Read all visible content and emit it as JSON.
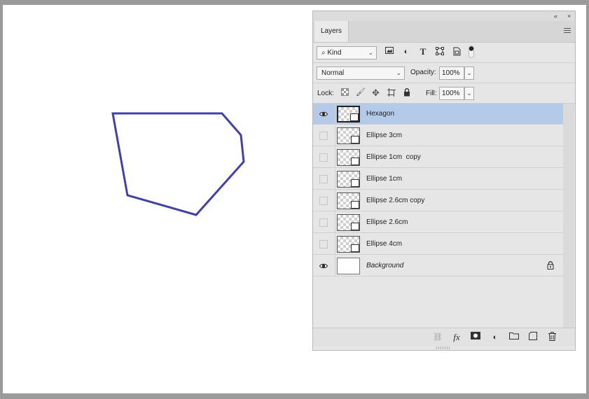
{
  "canvas": {
    "shape_name": "Hexagon",
    "stroke_color": "#4040b0"
  },
  "panel": {
    "title_buttons": {
      "collapse": "«",
      "close": "×"
    },
    "tab_label": "Layers",
    "menu_icon": "panel-menu-icon",
    "filter": {
      "kind_label": "Kind",
      "icons": [
        "image-filter-icon",
        "adjustment-filter-icon",
        "type-filter-icon",
        "shape-filter-icon",
        "smart-object-filter-icon"
      ]
    },
    "blend": {
      "mode": "Normal",
      "opacity_label": "Opacity:",
      "opacity_value": "100%"
    },
    "lock": {
      "label": "Lock:",
      "icons": [
        "lock-transparent-icon",
        "lock-image-icon",
        "lock-position-icon",
        "lock-artboard-icon",
        "lock-all-icon"
      ],
      "fill_label": "Fill:",
      "fill_value": "100%"
    },
    "layers": [
      {
        "name": "Hexagon",
        "visible": true,
        "selected": true,
        "type": "shape"
      },
      {
        "name": "Ellipse 3cm",
        "visible": false,
        "selected": false,
        "type": "shape"
      },
      {
        "name": "Ellipse 1cm  copy",
        "visible": false,
        "selected": false,
        "type": "shape"
      },
      {
        "name": "Ellipse 1cm",
        "visible": false,
        "selected": false,
        "type": "shape"
      },
      {
        "name": "Ellipse 2.6cm copy",
        "visible": false,
        "selected": false,
        "type": "shape"
      },
      {
        "name": "Ellipse 2.6cm",
        "visible": false,
        "selected": false,
        "type": "shape"
      },
      {
        "name": "Ellipse 4cm",
        "visible": false,
        "selected": false,
        "type": "shape"
      },
      {
        "name": "Background",
        "visible": true,
        "selected": false,
        "type": "background",
        "locked": true
      }
    ],
    "bottom_icons": [
      "link-layers-icon",
      "fx-icon",
      "add-mask-icon",
      "adjustment-layer-icon",
      "new-group-icon",
      "new-layer-icon",
      "delete-layer-icon"
    ],
    "colors": {
      "selected_row": "#b3cbe8",
      "panel_bg": "#e6e6e6"
    }
  }
}
